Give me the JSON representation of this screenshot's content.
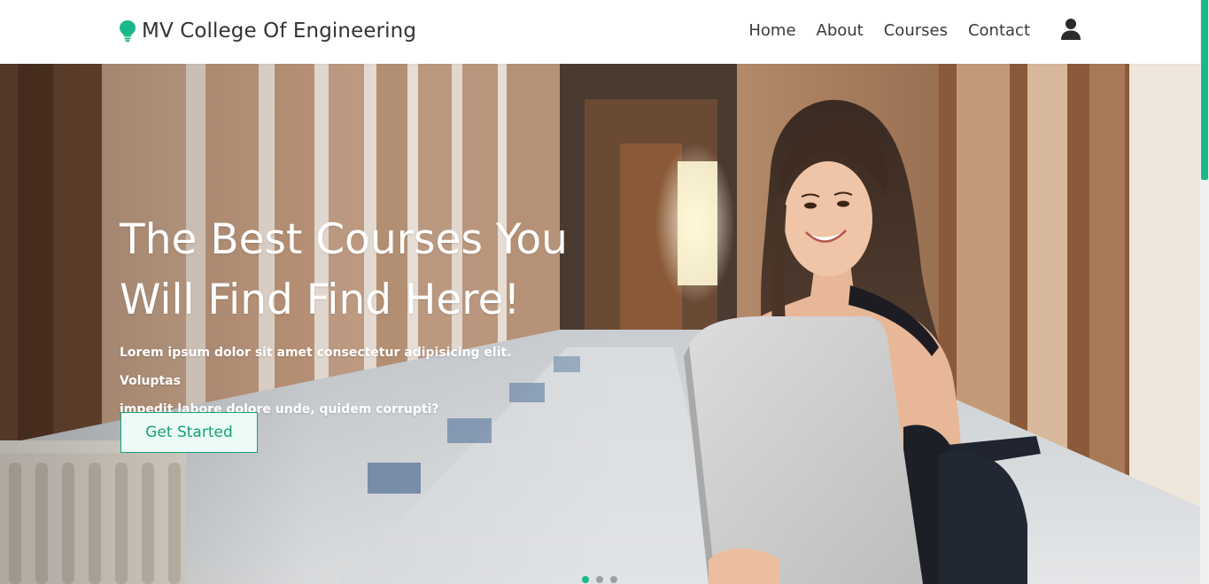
{
  "header": {
    "brand_name": "MV College Of Engineering",
    "brand_icon": "lightbulb-icon",
    "nav": [
      {
        "label": "Home"
      },
      {
        "label": "About"
      },
      {
        "label": "Courses"
      },
      {
        "label": "Contact"
      }
    ],
    "user_icon": "user-icon"
  },
  "hero": {
    "title_line1": "The Best Courses You",
    "title_line2": "Will Find Find Here!",
    "text_line1": "Lorem ipsum dolor sit amet consectetur adipisicing elit. Voluptas",
    "text_line2": "impedit labore dolore unde, quidem corrupti?",
    "cta_label": "Get Started",
    "slides": 3,
    "active_slide": 1
  },
  "colors": {
    "accent": "#19b88a",
    "nav_text": "#3a3a3a",
    "hero_text": "#ffffff"
  }
}
